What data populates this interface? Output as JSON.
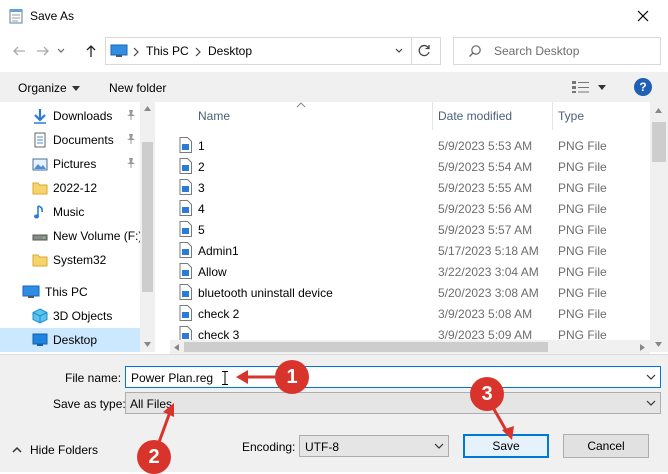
{
  "window": {
    "title": "Save As"
  },
  "address": {
    "segments": [
      "This PC",
      "Desktop"
    ]
  },
  "search": {
    "placeholder": "Search Desktop"
  },
  "toolbar": {
    "organize": "Organize",
    "new_folder": "New folder"
  },
  "nav": {
    "items": [
      {
        "label": "Downloads",
        "icon": "download-icon",
        "pinned": true
      },
      {
        "label": "Documents",
        "icon": "documents-icon",
        "pinned": true
      },
      {
        "label": "Pictures",
        "icon": "pictures-icon",
        "pinned": true
      },
      {
        "label": "2022-12",
        "icon": "folder-icon"
      },
      {
        "label": "Music",
        "icon": "music-icon"
      },
      {
        "label": "New Volume (F:)",
        "icon": "drive-icon"
      },
      {
        "label": "System32",
        "icon": "folder-icon"
      },
      {
        "label": "This PC",
        "icon": "pc-icon"
      },
      {
        "label": "3D Objects",
        "icon": "3d-objects-icon"
      },
      {
        "label": "Desktop",
        "icon": "desktop-icon",
        "selected": true
      }
    ]
  },
  "columns": {
    "name": "Name",
    "date": "Date modified",
    "type": "Type"
  },
  "files": [
    {
      "name": "1",
      "date": "5/9/2023 5:53 AM",
      "type": "PNG File"
    },
    {
      "name": "2",
      "date": "5/9/2023 5:54 AM",
      "type": "PNG File"
    },
    {
      "name": "3",
      "date": "5/9/2023 5:55 AM",
      "type": "PNG File"
    },
    {
      "name": "4",
      "date": "5/9/2023 5:56 AM",
      "type": "PNG File"
    },
    {
      "name": "5",
      "date": "5/9/2023 5:57 AM",
      "type": "PNG File"
    },
    {
      "name": "Admin1",
      "date": "5/17/2023 5:18 AM",
      "type": "PNG File"
    },
    {
      "name": "Allow",
      "date": "3/22/2023 3:04 AM",
      "type": "PNG File"
    },
    {
      "name": "bluetooth uninstall device",
      "date": "5/20/2023 3:08 AM",
      "type": "PNG File"
    },
    {
      "name": "check 2",
      "date": "3/9/2023 5:08 AM",
      "type": "PNG File"
    },
    {
      "name": "check 3",
      "date": "3/9/2023 5:09 AM",
      "type": "PNG File"
    }
  ],
  "form": {
    "file_name_label": "File name:",
    "file_name_value": "Power Plan.reg",
    "save_type_label": "Save as type:",
    "save_type_value": "All Files",
    "encoding_label": "Encoding:",
    "encoding_value": "UTF-8"
  },
  "actions": {
    "hide_folders": "Hide Folders",
    "save": "Save",
    "cancel": "Cancel"
  },
  "annotations": [
    "1",
    "2",
    "3"
  ],
  "colors": {
    "annotation": "#d9342b",
    "selection": "#cce8ff",
    "accent": "#0078d7"
  }
}
